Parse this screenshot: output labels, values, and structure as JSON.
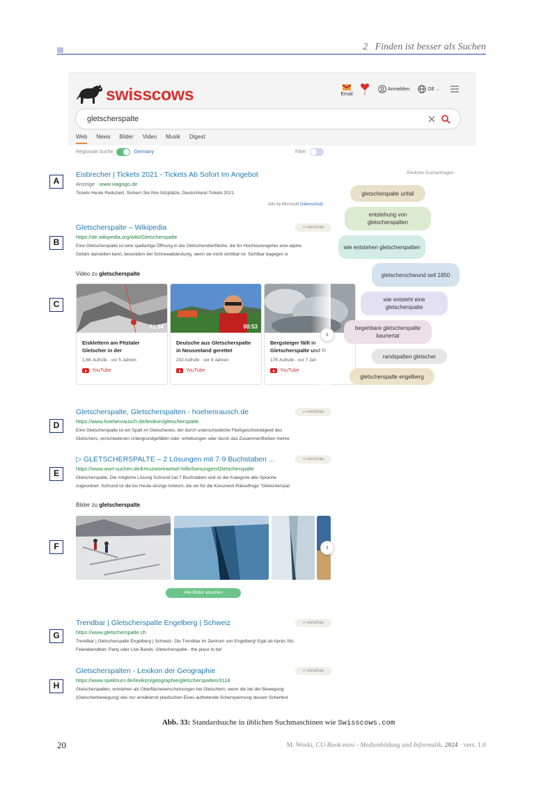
{
  "page_header": {
    "chapter": "2",
    "title": "Finden ist besser als Suchen"
  },
  "app": {
    "brand": "swisscows",
    "email_label": "Email",
    "heart_count": "2",
    "login_label": "Anmelden",
    "language": "DE",
    "query": "gletscherspalte",
    "tabs": [
      "Web",
      "News",
      "Bilder",
      "Video",
      "Musik",
      "Digest"
    ],
    "regional_label": "Regionale Suche",
    "country": "Germany",
    "filter_label": "Filter",
    "preview_label": "vorschau",
    "ads_by": "Ads by Microsoft",
    "privacy": "Datenschutz"
  },
  "ad": {
    "title": "Eisbrecher | Tickets 2021 - Tickets Ab Sofort Im Angebot",
    "prefix": "Anzeige",
    "url": "www.viagogo.de",
    "desc": "Tickets Heute Reduziert, Sichern Sie Ihre Sitzplätze, Deutschland Tickets 2021"
  },
  "results": [
    {
      "title": "Gletscherspalte – Wikipedia",
      "url": "https://de.wikipedia.org/wiki/Gletscherspalte",
      "desc1": "Eine Gletscherspalte ist eine spaltartige Öffnung in der Gletscheroberfläche, die für Hochtourengeher eine alpine",
      "desc2": "Gefahr darstellen kann, besonders bei Schneeabdeckung, wenn sie nicht sichtbar ist. Sichtbar dagegen si"
    },
    {
      "title": "Gletscherspalte, Gletscherspalten - hoehenrausch.de",
      "url": "https://www.hoehenrausch.de/lexikon/gletscherspalte",
      "desc1": "Eine Gletscherspalte ist ein Spalt im Gletschereis, der durch unterschiedliche Fließgeschwindigkeit des",
      "desc2": "Gletschers, verschiedenen Untergrundgefällen oder -erhebungen oder durch das Zusammenfließen mehre"
    },
    {
      "title": "▷ GLETSCHERSPALTE – 2 Lösungen mit 7-9 Buchstaben ...",
      "url": "https://www.wort-suchen.de/kreuzwortraetsel-hilfe/loesungen/Gletscherspalte",
      "desc1": "Gletscherspalte. Die mögliche Lösung Schrund hat 7 Buchstaben und ist der Kategorie alte Sprache",
      "desc2": "zugeordnet. Schrund ist die bis Heute einzige Antwort, die wir für die Kreuzwort-Rätselfrage \"Gletscherspal"
    },
    {
      "title": "Trendbar | Gletscherspalte Engelberg | Schweiz",
      "url": "https://www.gletscherspalte.ch",
      "desc1": "Trendbar | Gletscherspalte Engelberg | Schweiz. Die Trendbar im Zentrum von Engelberg! Egal ob Après Ski,",
      "desc2": "Feierabendbier, Party oder Live Bands: Gletscherspalte - the place to be!"
    },
    {
      "title": "Gletscherspalten - Lexikon der Geographie",
      "url": "https://www.spektrum.de/lexikon/geographie/gletscherspalten/3118",
      "desc1": "Gletscherspalten, entstehen als Oberflächenerscheinungen bei Gletschern, wenn die bei der Bewegung",
      "desc2": "(Gletscherbewegung) des nur annähernd plastischen Eises auftretende Scherspannung dessen Scherfest"
    }
  ],
  "videos": {
    "heading_prefix": "Video zu",
    "heading_query": "gletscherspalte",
    "items": [
      {
        "duration": "01:34",
        "title1": "Eisklettern am Pitztaler",
        "title2": "Gletscher in der",
        "meta": "1.6K Aufrufe · vor 5 Jahren",
        "source": "YouTube"
      },
      {
        "duration": "00:53",
        "title1": "Deutsche aus Gletscherspalte",
        "title2": "in Neuseeland gerettet",
        "meta": "242 Aufrufe · vor 9 Jahren",
        "source": "YouTube"
      },
      {
        "duration": "",
        "title1": "Bergsteiger fällt in",
        "title2": "Gletscherspalte und fil",
        "meta": "17K Aufrufe · vor 7 Jah",
        "source": "YouTube"
      }
    ]
  },
  "images": {
    "heading_prefix": "Bilder zu",
    "heading_query": "gletscherspalte",
    "button": "Alle Bilder ansehen"
  },
  "related": {
    "heading": "Ähnliche Suchanfragen:",
    "chips": [
      {
        "label": "gletscherspalte unfall",
        "color": "#e8e0c8"
      },
      {
        "label": "entstehung von gletscherspalten",
        "color": "#dcebd0"
      },
      {
        "label": "wie entstehen gletscherspalten",
        "color": "#d2ece6"
      },
      {
        "label": "gletscherschwund seit 1850",
        "color": "#d4e2f0"
      },
      {
        "label": "wie entsteht eine gletscherspalte",
        "color": "#e4e0f4"
      },
      {
        "label": "begehbare gletscherspalte kaunertal",
        "color": "#ecdfe6"
      },
      {
        "label": "randspalten gletscher",
        "color": "#e6e6e6"
      },
      {
        "label": "gletscherspalte engelberg",
        "color": "#ece2ca"
      }
    ]
  },
  "labels": [
    "A",
    "B",
    "C",
    "D",
    "E",
    "F",
    "G",
    "H"
  ],
  "caption": {
    "prefix": "Abb. 33:",
    "text": "Standardsuche in üblichen Suchmaschinen wie",
    "site": "Swisscows.com"
  },
  "footer": {
    "page": "20",
    "author": "M. Woski,",
    "book": "CU-Book-mini - Medienbildung und Informatik,",
    "year": "2024",
    "version": "· vers. 1.0"
  }
}
